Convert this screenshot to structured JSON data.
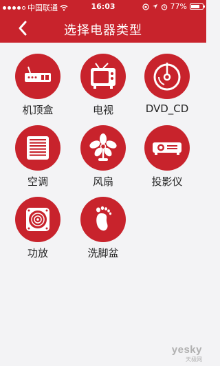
{
  "status": {
    "carrier": "中国联通",
    "time": "16:03",
    "battery": "77%",
    "battery_level": 0.77
  },
  "nav": {
    "title": "选择电器类型"
  },
  "devices": [
    {
      "label": "机顶盒",
      "icon": "set-top-box-icon"
    },
    {
      "label": "电视",
      "icon": "tv-icon"
    },
    {
      "label": "DVD_CD",
      "icon": "disc-icon"
    },
    {
      "label": "空调",
      "icon": "air-conditioner-icon"
    },
    {
      "label": "风扇",
      "icon": "fan-icon"
    },
    {
      "label": "投影仪",
      "icon": "projector-icon"
    },
    {
      "label": "功放",
      "icon": "amplifier-icon"
    },
    {
      "label": "洗脚盆",
      "icon": "foot-bath-icon"
    }
  ],
  "watermark": {
    "main": "yesky",
    "sub": "天极网"
  },
  "colors": {
    "accent": "#c8232c",
    "background": "#f3f3f5"
  }
}
